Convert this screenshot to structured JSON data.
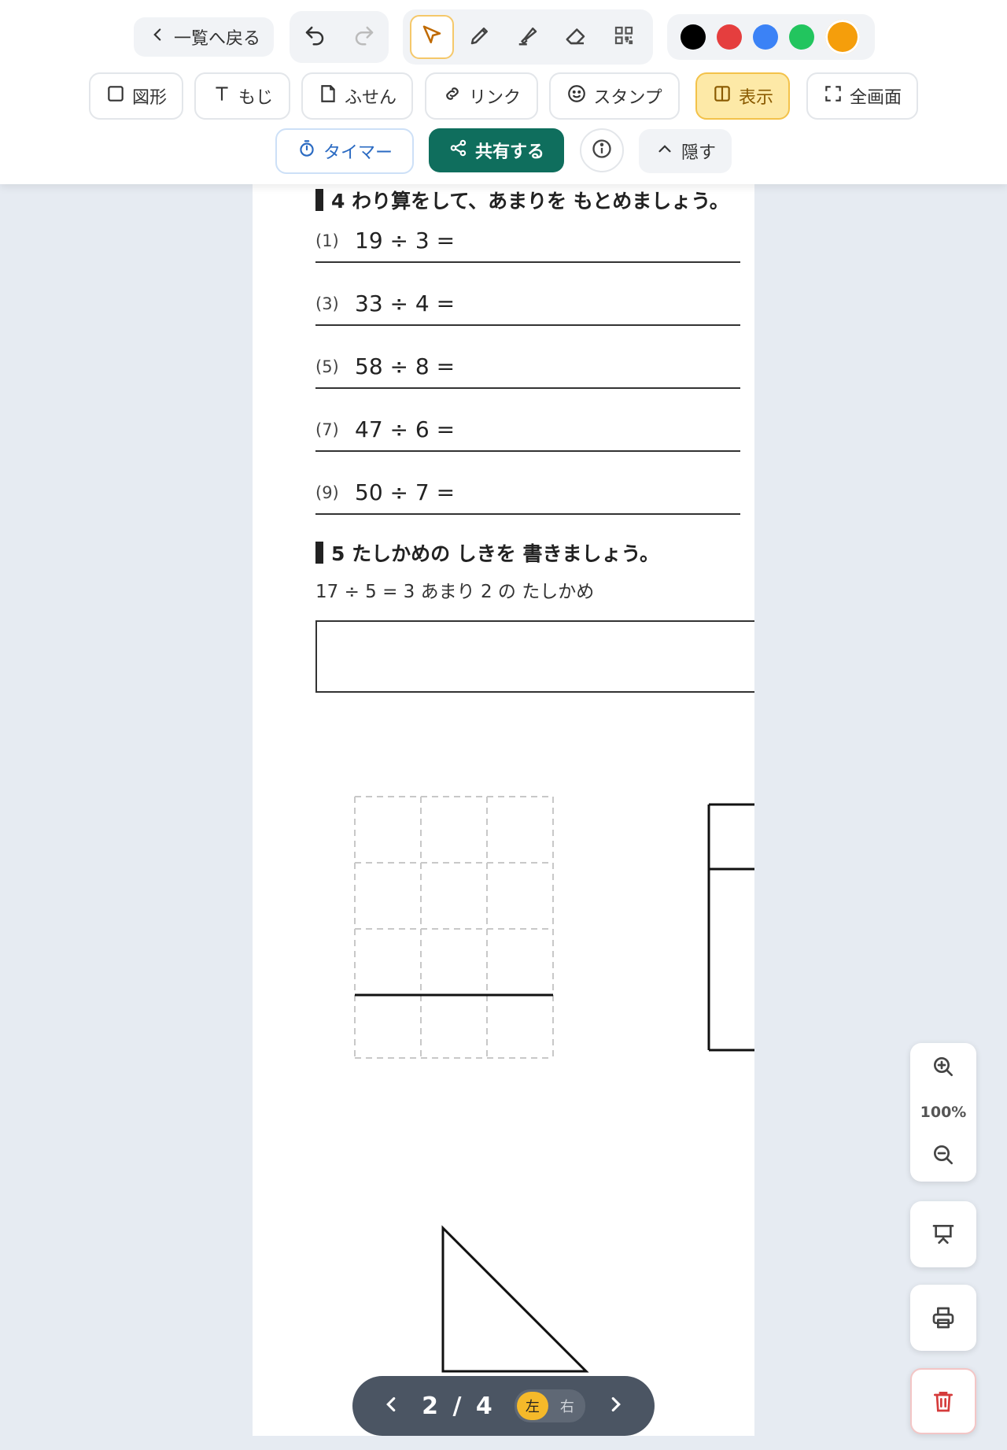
{
  "toolbar": {
    "back_label": "一覧へ戻る",
    "colors": [
      "#000000",
      "#e53e3e",
      "#3b82f6",
      "#22c55e",
      "#f59e0b"
    ],
    "buttons": {
      "shape": "図形",
      "text": "もじ",
      "sticky": "ふせん",
      "link": "リンク",
      "stamp": "スタンプ",
      "view": "表示",
      "fullscreen": "全画面",
      "timer": "タイマー",
      "share": "共有する",
      "hide": "隠す"
    },
    "icons": [
      "undo-icon",
      "redo-icon",
      "select-cursor-icon",
      "pen-icon",
      "highlighter-icon",
      "eraser-icon",
      "qr-code-icon"
    ]
  },
  "worksheet": {
    "section4_title": "4 わり算をして、あまりを もとめましょう。",
    "problems": [
      {
        "num": "(1)",
        "expr": "19 ÷ 3 ="
      },
      {
        "num": "(3)",
        "expr": "33 ÷ 4 ="
      },
      {
        "num": "(5)",
        "expr": "58 ÷ 8 ="
      },
      {
        "num": "(7)",
        "expr": "47 ÷ 6 ="
      },
      {
        "num": "(9)",
        "expr": "50 ÷ 7 ="
      }
    ],
    "section5_title": "5 たしかめの しきを 書きましょう。",
    "section5_example": "17 ÷ 5 = 3 あまり 2 の たしかめ"
  },
  "zoom": {
    "level": "100%"
  },
  "pager": {
    "current": "2",
    "total": "4",
    "left": "左",
    "right": "右"
  }
}
